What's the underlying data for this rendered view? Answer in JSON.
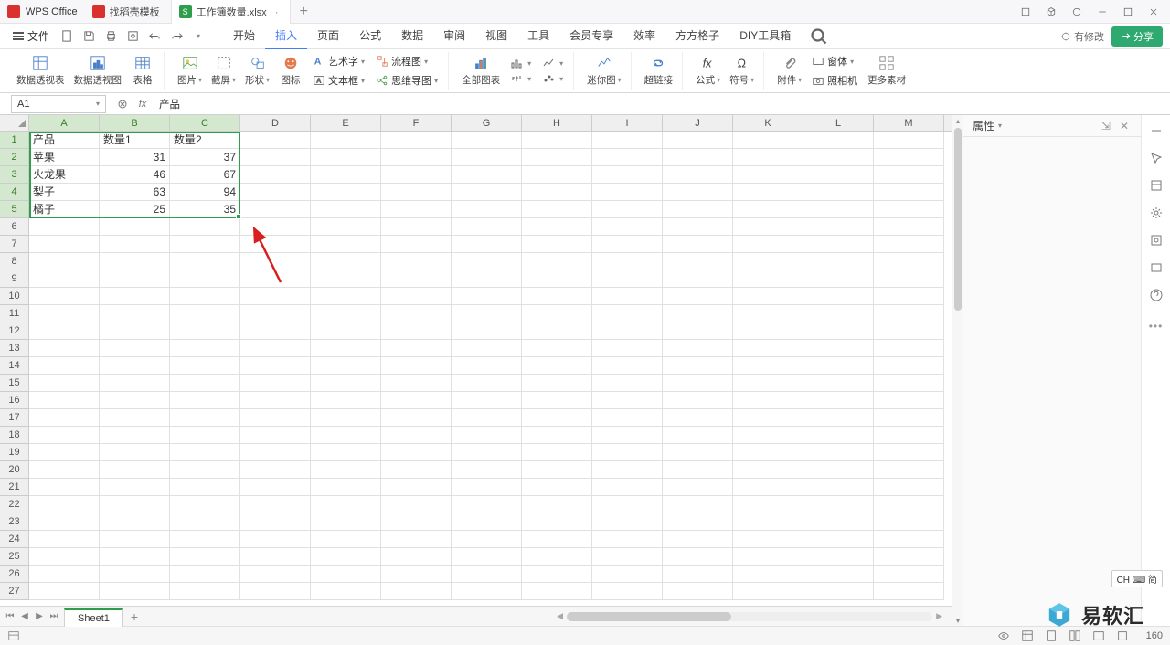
{
  "app": {
    "name": "WPS Office"
  },
  "tabs": [
    {
      "label": "找稻壳模板",
      "icon": "red"
    },
    {
      "label": "工作簿数量.xlsx",
      "icon": "green",
      "iconText": "S",
      "active": true,
      "modified": "·"
    }
  ],
  "menu": {
    "file": "文件",
    "items": [
      "开始",
      "插入",
      "页面",
      "公式",
      "数据",
      "审阅",
      "视图",
      "工具",
      "会员专享",
      "效率",
      "方方格子",
      "DIY工具箱"
    ],
    "active_index": 1,
    "modify": "有修改",
    "share": "分享"
  },
  "ribbon": {
    "pivot_table": "数据透视表",
    "pivot_chart": "数据透视图",
    "table": "表格",
    "picture": "图片",
    "screenshot": "截屏",
    "shape": "形状",
    "icons": "图标",
    "art": "艺术字",
    "flowchart": "流程图",
    "textbox": "文本框",
    "mindmap": "思维导图",
    "all_charts": "全部图表",
    "sparkline": "迷你图",
    "hyperlink": "超链接",
    "formula": "公式",
    "symbol": "符号",
    "attachment": "附件",
    "object": "窗体",
    "camera": "照相机",
    "more_assets": "更多素材"
  },
  "formula": {
    "name_box": "A1",
    "value": "产品"
  },
  "columns": [
    "A",
    "B",
    "C",
    "D",
    "E",
    "F",
    "G",
    "H",
    "I",
    "J",
    "K",
    "L",
    "M"
  ],
  "chart_data": {
    "type": "table",
    "headers": [
      "产品",
      "数量1",
      "数量2"
    ],
    "rows": [
      [
        "苹果",
        31,
        37
      ],
      [
        "火龙果",
        46,
        67
      ],
      [
        "梨子",
        63,
        94
      ],
      [
        "橘子",
        25,
        35
      ]
    ]
  },
  "selection": {
    "range": "A1:C5"
  },
  "side_panel": {
    "title": "属性"
  },
  "sheet": {
    "name": "Sheet1"
  },
  "status": {
    "zoom": "160",
    "lang": "CH ⌨ 简"
  },
  "watermark": "易软汇"
}
